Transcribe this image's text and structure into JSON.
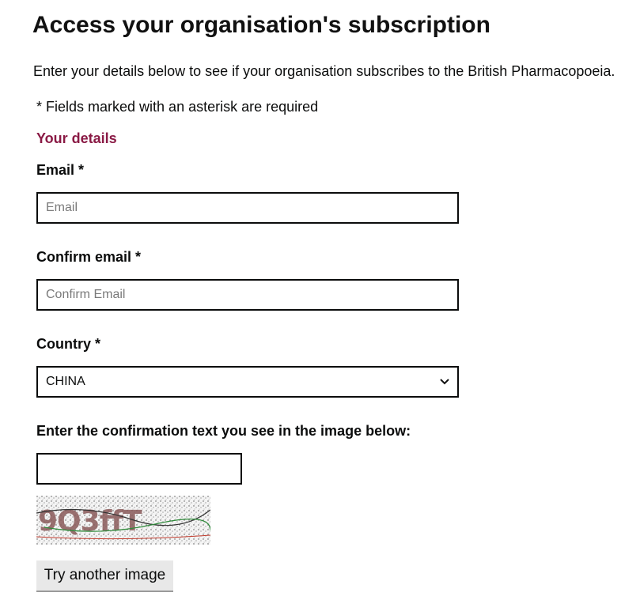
{
  "page": {
    "title": "Access your organisation's subscription",
    "intro": "Enter your details below to see if your organisation subscribes to the British Pharmacopoeia.",
    "required_note": "* Fields marked with an asterisk are required"
  },
  "form": {
    "section_heading": "Your details",
    "email": {
      "label": "Email",
      "required_marker": "*",
      "value": "",
      "placeholder": "Email"
    },
    "confirm_email": {
      "label": "Confirm email",
      "required_marker": "*",
      "value": "",
      "placeholder": "Confirm Email"
    },
    "country": {
      "label": "Country",
      "required_marker": "*",
      "selected": "CHINA"
    },
    "captcha": {
      "label": "Enter the confirmation text you see in the image below:",
      "value": "",
      "image_text": "9Q3ffT",
      "retry_label": "Try another image"
    }
  },
  "colors": {
    "section_heading": "#8a1a45",
    "text": "#0b0c0c",
    "border": "#0b0c0c",
    "button_bg": "#e8e8e8"
  },
  "icons": {
    "select_arrow": "chevron-down-icon"
  }
}
